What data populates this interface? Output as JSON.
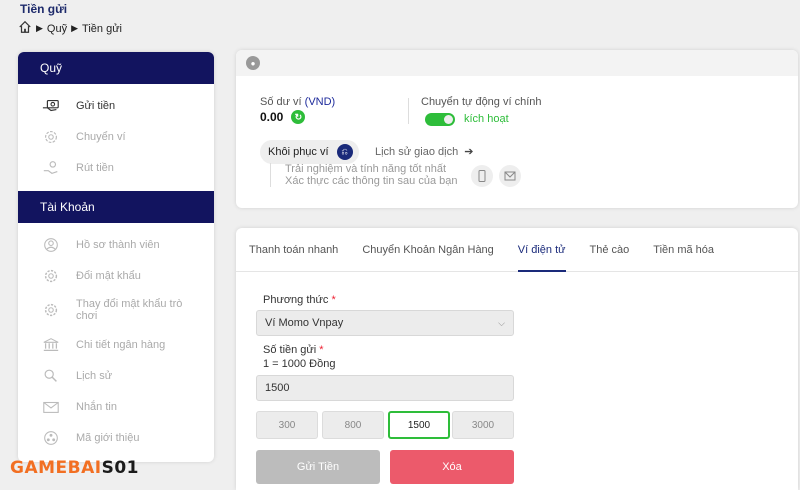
{
  "header": {
    "title": "Tiền gửi",
    "breadcrumb": [
      "Quỹ",
      "Tiền gửi"
    ],
    "breadcrumb_sep": "▶"
  },
  "sidebar": {
    "group1_title": "Quỹ",
    "group1_items": [
      {
        "label": "Gửi tiền",
        "icon": "money-hand-icon",
        "active": true
      },
      {
        "label": "Chuyển ví",
        "icon": "transfer-gear-icon",
        "active": false
      },
      {
        "label": "Rút tiền",
        "icon": "withdraw-hand-icon",
        "active": false
      }
    ],
    "group2_title": "Tài Khoản",
    "group2_items": [
      {
        "label": "Hồ sơ thành viên",
        "icon": "user-icon"
      },
      {
        "label": "Đổi mật khẩu",
        "icon": "gear-icon"
      },
      {
        "label": "Thay đổi mật khẩu trò chơi",
        "icon": "gear-icon"
      },
      {
        "label": "Chi tiết ngân hàng",
        "icon": "bank-icon"
      },
      {
        "label": "Lịch sử",
        "icon": "search-icon"
      },
      {
        "label": "Nhắn tin",
        "icon": "mail-icon"
      },
      {
        "label": "Mã giới thiệu",
        "icon": "share-icon"
      }
    ]
  },
  "wallet": {
    "balance_label": "Số dư ví",
    "balance_unit": "(VND)",
    "balance_value": "0.00",
    "auto_transfer_label": "Chuyển tự động ví chính",
    "auto_transfer_status": "kích hoạt",
    "restore_label": "Khôi phục ví",
    "history_label": "Lịch sử giao dịch",
    "history_arrow": "➔",
    "hint_line1": "Trải nghiệm và tính năng tốt nhất",
    "hint_line2": "Xác thực các thông tin sau của bạn"
  },
  "tabs": [
    {
      "label": "Thanh toán nhanh",
      "active": false
    },
    {
      "label": "Chuyển Khoản Ngân Hàng",
      "active": false
    },
    {
      "label": "Ví điện tử",
      "active": true
    },
    {
      "label": "Thẻ cào",
      "active": false
    },
    {
      "label": "Tiền mã hóa",
      "active": false
    }
  ],
  "form": {
    "method_label": "Phương thức",
    "method_value": "Ví Momo Vnpay",
    "amount_label": "Số tiền gửi",
    "rate_text": "1 = 1000 Đồng",
    "amount_value": "1500",
    "required_mark": "*",
    "quick_amounts": [
      "300",
      "800",
      "1500",
      "3000"
    ],
    "selected_amount": "1500",
    "submit_label": "Gửi Tiền",
    "clear_label": "Xóa"
  },
  "watermark": {
    "part1": "GAMEBAI",
    "part2": "S01"
  },
  "colors": {
    "navy": "#12145f",
    "green": "#2ebd3a",
    "red": "#ec5a6b"
  }
}
